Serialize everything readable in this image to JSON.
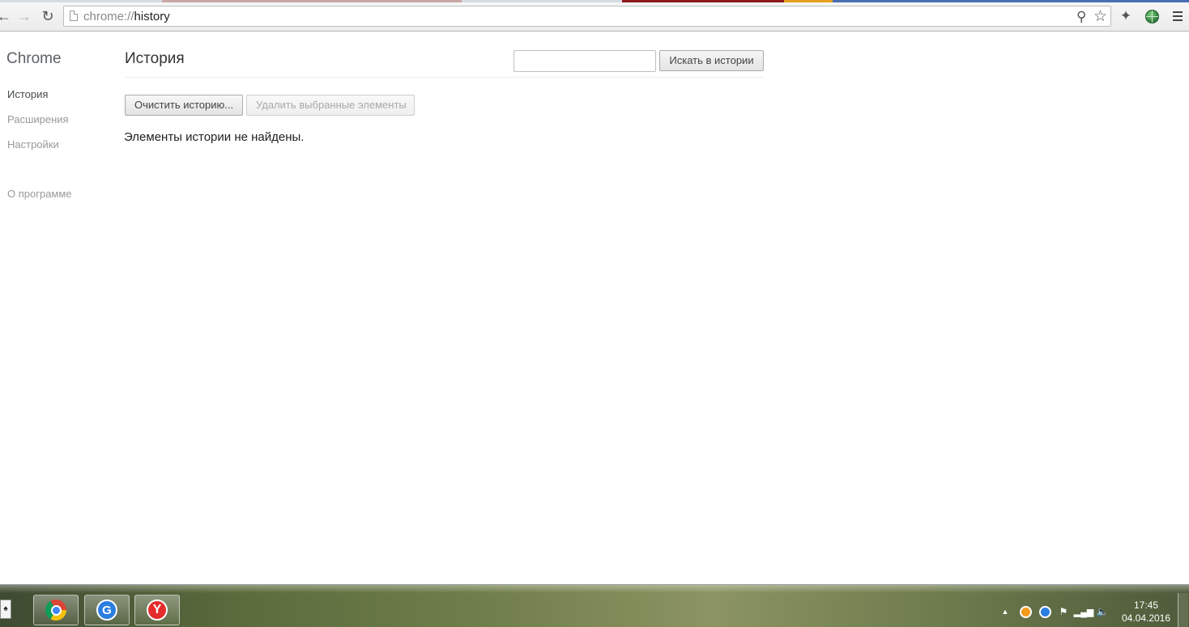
{
  "browser": {
    "url_scheme": "chrome://",
    "url_path": "history",
    "icons": {
      "back": "back-arrow-icon",
      "forward": "forward-arrow-icon",
      "reload": "reload-icon",
      "page": "page-icon",
      "zoom": "zoom-icon",
      "bookmark": "star-icon",
      "extension": "puzzle-icon",
      "globe": "globe-icon",
      "menu": "hamburger-menu-icon"
    }
  },
  "sidebar": {
    "brand": "Chrome",
    "items": [
      {
        "label": "История",
        "active": true
      },
      {
        "label": "Расширения",
        "active": false
      },
      {
        "label": "Настройки",
        "active": false
      },
      {
        "label": "О программе",
        "active": false
      }
    ]
  },
  "main": {
    "title": "История",
    "search": {
      "value": "",
      "placeholder": "",
      "button_label": "Искать в истории"
    },
    "clear_button": "Очистить историю...",
    "delete_button": "Удалить выбранные элементы",
    "empty_message": "Элементы истории не найдены."
  },
  "taskbar": {
    "apps": [
      "solitaire-icon",
      "chrome-icon",
      "g-app-icon",
      "yandex-icon"
    ],
    "tray_icons": [
      "tray-expand-icon",
      "orange-app-icon",
      "blue-app-icon",
      "flag-icon",
      "network-icon",
      "volume-icon"
    ],
    "time": "17:45",
    "date": "04.04.2016"
  },
  "colors": {
    "accent_link_active": "#464a4f",
    "link_inactive": "#999999",
    "brand_text": "#5c6166"
  }
}
